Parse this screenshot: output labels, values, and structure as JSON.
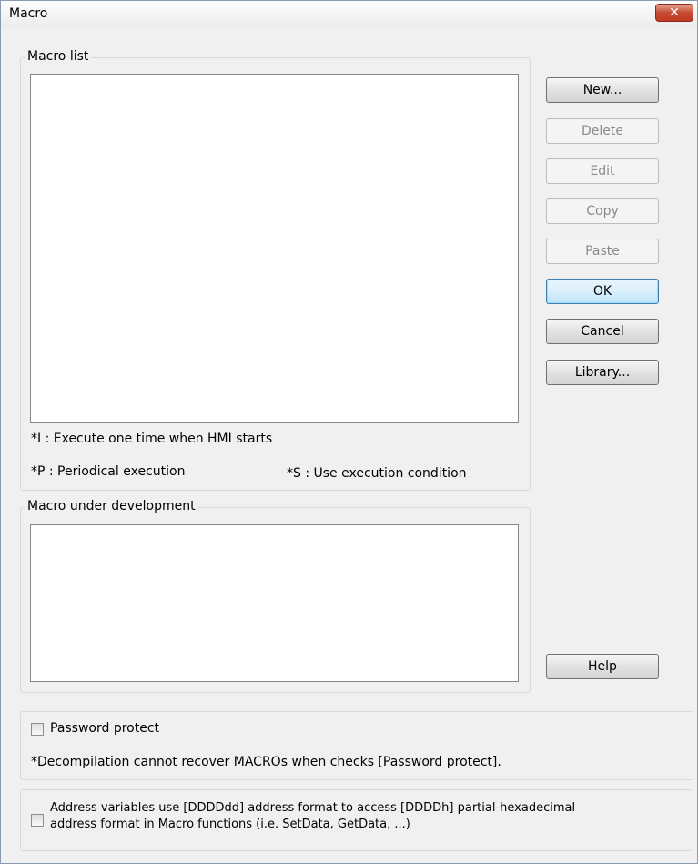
{
  "window": {
    "title": "Macro",
    "close_symbol": "✕"
  },
  "macro_list": {
    "label": "Macro list",
    "note_i": "*I : Execute one time when HMI starts",
    "note_p": "*P : Periodical execution",
    "note_s": "*S : Use execution condition"
  },
  "buttons": {
    "new": "New...",
    "delete": "Delete",
    "edit": "Edit",
    "copy": "Copy",
    "paste": "Paste",
    "ok": "OK",
    "cancel": "Cancel",
    "library": "Library...",
    "help": "Help"
  },
  "macro_dev": {
    "label": "Macro under development"
  },
  "password": {
    "label": "Password protect",
    "checked": false,
    "note": "*Decompilation cannot recover MACROs when checks [Password protect]."
  },
  "address": {
    "line1": "Address variables use [DDDDdd] address format to access [DDDDh] partial-hexadecimal",
    "line2": "address format in Macro functions (i.e. SetData, GetData, ...)",
    "checked": false
  }
}
